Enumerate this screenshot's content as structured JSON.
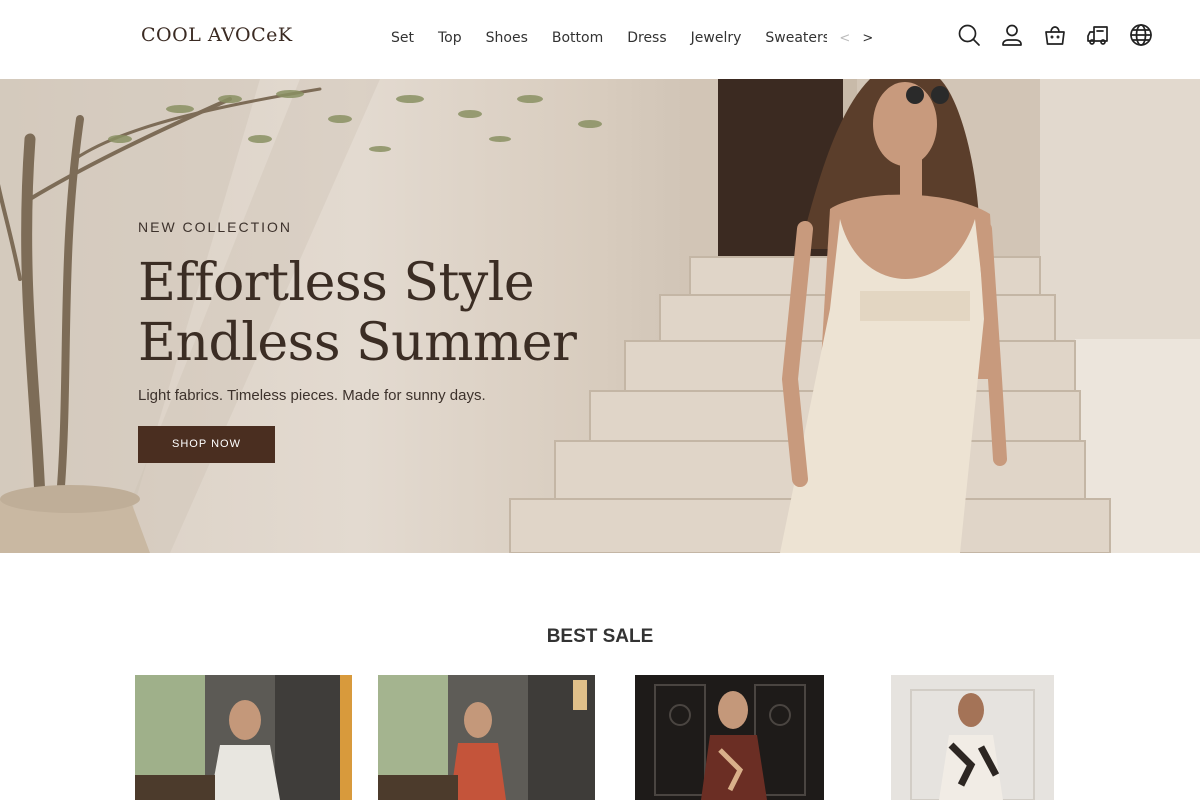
{
  "brand": {
    "logo": "COOL AVOCeK"
  },
  "nav": {
    "items": [
      "Set",
      "Top",
      "Shoes",
      "Bottom",
      "Dress",
      "Jewelry",
      "Sweaters"
    ],
    "prev_arrow": "<",
    "next_arrow": ">"
  },
  "header_icons": [
    "search-icon",
    "account-icon",
    "cart-icon",
    "shipping-icon",
    "language-icon"
  ],
  "hero": {
    "eyebrow": "NEW COLLECTION",
    "headline_line1": "Effortless Style",
    "headline_line2": "Endless Summer",
    "subline": "Light fabrics. Timeless pieces. Made for sunny days.",
    "cta": "SHOP NOW"
  },
  "best_sale": {
    "title": "BEST SALE"
  },
  "colors": {
    "accent": "#4a2e20",
    "headline": "#3b2d24",
    "hero_bg": "#e3dad0"
  }
}
